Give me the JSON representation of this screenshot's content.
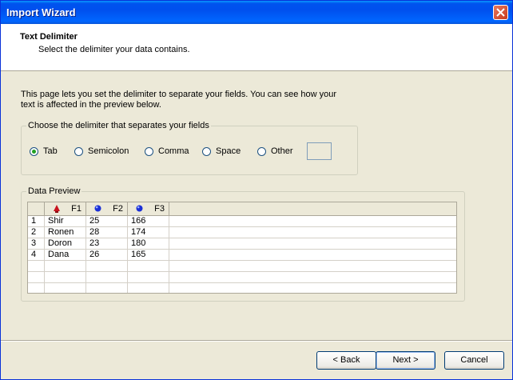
{
  "window": {
    "title": "Import Wizard"
  },
  "header": {
    "title": "Text Delimiter",
    "subtitle": "Select the delimiter your data contains."
  },
  "intro": "This page lets you set the delimiter to separate your fields.  You can see how your text is affected in the preview below.",
  "delimiter": {
    "legend": "Choose the delimiter that separates your fields",
    "options": [
      "Tab",
      "Semicolon",
      "Comma",
      "Space",
      "Other"
    ],
    "selected": "Tab",
    "other_value": ""
  },
  "preview": {
    "legend": "Data Preview",
    "columns": [
      "F1",
      "F2",
      "F3"
    ],
    "rows": [
      [
        "1",
        "Shir",
        "25",
        "166"
      ],
      [
        "2",
        "Ronen",
        "28",
        "174"
      ],
      [
        "3",
        "Doron",
        "23",
        "180"
      ],
      [
        "4",
        "Dana",
        "26",
        "165"
      ]
    ]
  },
  "buttons": {
    "back": "< Back",
    "next": "Next >",
    "cancel": "Cancel"
  },
  "icons": {
    "f1": "text-type-icon",
    "f2": "number-type-icon",
    "f3": "number-type-icon"
  }
}
